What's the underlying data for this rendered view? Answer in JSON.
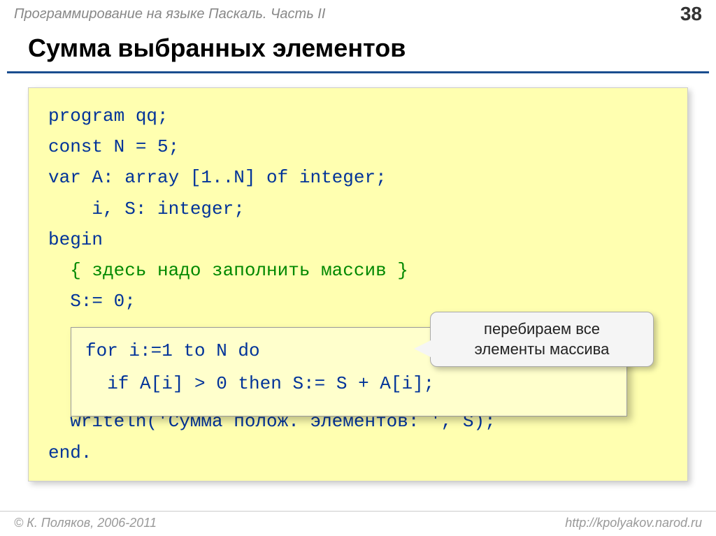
{
  "header": {
    "course": "Программирование на языке Паскаль. Часть II",
    "page_number": "38"
  },
  "title": "Сумма выбранных элементов",
  "code": {
    "line1": "program qq;",
    "line2": "const N = 5;",
    "line3": "var A: array [1..N] of integer;",
    "line4": "    i, S: integer;",
    "line5": "begin",
    "line6": "  { здесь надо заполнить массив }",
    "line7": "  S:= 0;",
    "line8_box1": "for i:=1 to N do",
    "line8_box2": "  if A[i] > 0 then S:= S + A[i];",
    "line9": "  writeln('Сумма полож. элементов: ', S);",
    "line10": "end."
  },
  "callout": {
    "text1": "перебираем все",
    "text2": "элементы массива"
  },
  "footer": {
    "copyright": "© К. Поляков, 2006-2011",
    "url": "http://kpolyakov.narod.ru"
  }
}
